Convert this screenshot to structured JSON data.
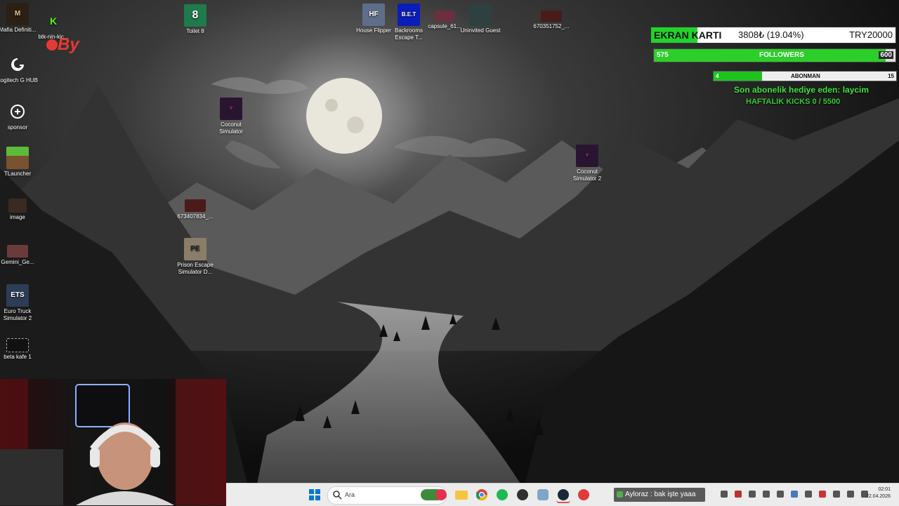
{
  "desktop": {
    "icons": [
      {
        "label": "Mafia Definiti...",
        "icon": "mafia-icon"
      },
      {
        "label": "btk-nin-kic...",
        "icon": "kick-icon"
      },
      {
        "label": "Logitech G HUB",
        "icon": "logitech-icon"
      },
      {
        "label": "sponsor",
        "icon": "sponsor-icon"
      },
      {
        "label": "TLauncher",
        "icon": "minecraft-icon"
      },
      {
        "label": "image",
        "icon": "image-icon"
      },
      {
        "label": "Gemini_Ge...",
        "icon": "gemini-icon"
      },
      {
        "label": "Euro Truck Simulator 2",
        "icon": "truck-icon"
      },
      {
        "label": "beta kafe 1",
        "icon": "file-icon"
      },
      {
        "label": "Toilet 8",
        "icon": "toilet8-icon"
      },
      {
        "label": "Coconut Simulator",
        "icon": "coconut-icon"
      },
      {
        "label": "673407834_...",
        "icon": "image-icon"
      },
      {
        "label": "Prison Escape Simulator D...",
        "icon": "prison-icon"
      },
      {
        "label": "House Flipper",
        "icon": "house-icon"
      },
      {
        "label": "Backrooms Escape T...",
        "icon": "backrooms-icon"
      },
      {
        "label": "capsule_61...",
        "icon": "image-icon"
      },
      {
        "label": "Uninvited Guest",
        "icon": "uninvited-icon"
      },
      {
        "label": "670351752_...",
        "icon": "image-icon"
      },
      {
        "label": "Coconut Simulator 2",
        "icon": "coconut-icon"
      }
    ],
    "logo_text": "By"
  },
  "overlay": {
    "gpu": {
      "label": "EKRAN KARTI",
      "value": "3808₺ (19.04%)",
      "goal": "TRY20000",
      "progress": 0.1904
    },
    "followers": {
      "current": "575",
      "label": "FOLLOWERS",
      "goal": "600",
      "progress": 0.958
    },
    "abonman": {
      "current": "4",
      "label": "ABONMAN",
      "goal": "15",
      "progress": 0.267
    },
    "gift_line": "Son abonelik hediye eden: laycim",
    "kicks_line": "HAFTALIK KICKS 0 / 5500"
  },
  "taskbar": {
    "search_placeholder": "Ara",
    "chat_banner": "Ayloraz : bak işte yaaa",
    "time": "02:01",
    "date": "22.04.2026",
    "icons": [
      "windows-start-icon",
      "search-icon",
      "widget-icon",
      "media-player-icon",
      "file-explorer-icon",
      "chrome-icon",
      "spotify-icon",
      "obs-icon",
      "settings-icon",
      "steam-icon",
      "app-icon"
    ]
  },
  "colors": {
    "accent_green": "#22d32a",
    "text_green": "#3ee23a"
  }
}
